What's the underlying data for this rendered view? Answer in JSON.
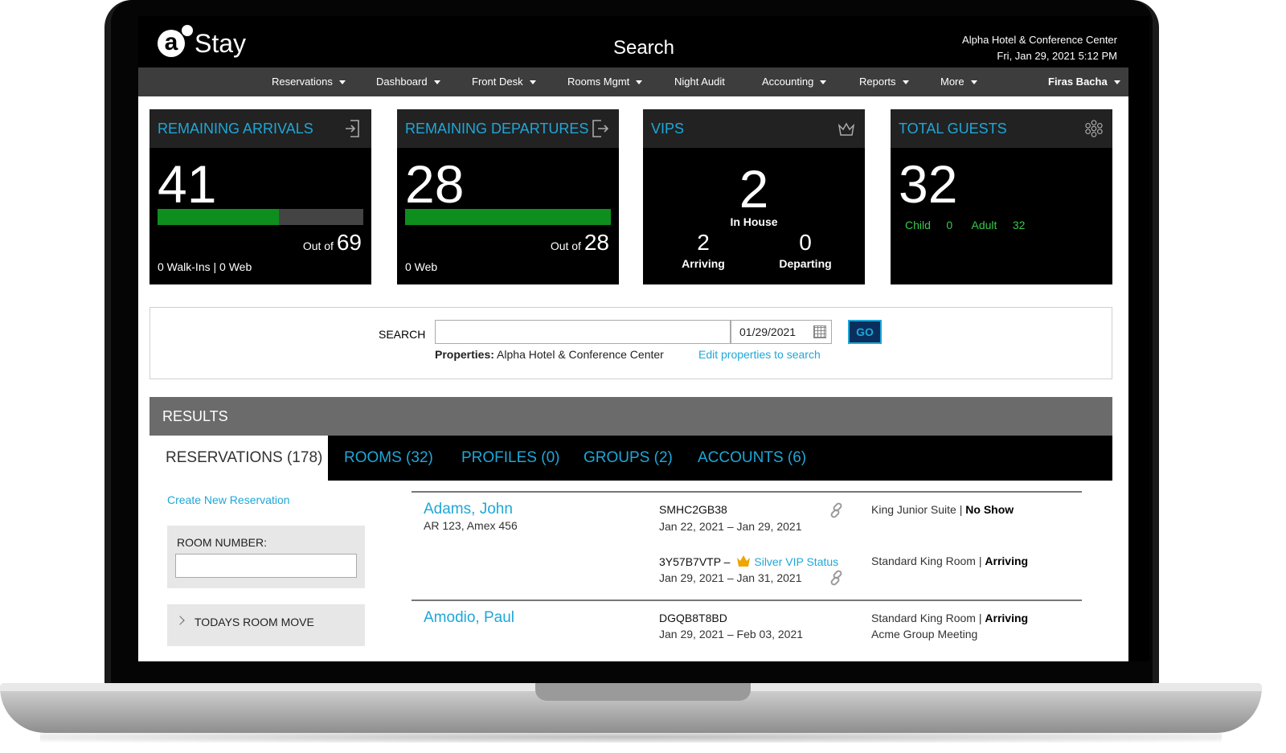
{
  "app": {
    "logo_letter": "a",
    "logo_name": "Stay",
    "page_title": "Search",
    "hotel_name": "Alpha Hotel & Conference Center",
    "datetime": "Fri, Jan 29, 2021 5:12 PM"
  },
  "nav": {
    "items": [
      "Reservations",
      "Dashboard",
      "Front Desk",
      "Rooms Mgmt",
      "Night Audit",
      "Accounting",
      "Reports",
      "More"
    ],
    "user": "Firas Bacha"
  },
  "cards": {
    "arrivals": {
      "title": "REMAINING ARRIVALS",
      "icon": "sign-in-icon",
      "value": "41",
      "out_of_label": "Out of",
      "out_of": "69",
      "progress": 0.59,
      "footer": "0 Walk-Ins   | 0 Web"
    },
    "departures": {
      "title": "REMAINING DEPARTURES",
      "icon": "sign-out-icon",
      "value": "28",
      "out_of_label": "Out of",
      "out_of": "28",
      "progress": 1.0,
      "footer": "0 Web"
    },
    "vips": {
      "title": "VIPS",
      "icon": "crown-icon",
      "value": "2",
      "in_house_label": "In House",
      "arriving": "2",
      "arriving_label": "Arriving",
      "departing": "0",
      "departing_label": "Departing"
    },
    "guests": {
      "title": "TOTAL GUESTS",
      "icon": "people-icon",
      "value": "32",
      "child_label": "Child",
      "child": "0",
      "adult_label": "Adult",
      "adult": "32"
    }
  },
  "search": {
    "label": "SEARCH",
    "query": "",
    "date": "01/29/2021",
    "go_label": "GO",
    "properties_label": "Properties:",
    "properties_value": "Alpha Hotel & Conference Center",
    "edit_link": "Edit properties to search"
  },
  "results": {
    "header": "RESULTS",
    "tabs": [
      "RESERVATIONS (178)",
      "ROOMS (32)",
      "PROFILES (0)",
      "GROUPS (2)",
      "ACCOUNTS (6)"
    ],
    "create_link": "Create New Reservation",
    "room_number_label": "ROOM NUMBER:",
    "room_number_value": "",
    "room_move_label": "TODAYS ROOM MOVE",
    "rows": [
      {
        "name": "Adams, John",
        "sub": "AR 123, Amex 456",
        "res": [
          {
            "conf": "SMHC2GB38",
            "dates": "Jan 22, 2021 – Jan 29, 2021",
            "room": "King Junior Suite |",
            "status": "No Show"
          },
          {
            "conf": "3Y57B7VTP –",
            "vip": "Silver VIP Status",
            "dates": "Jan 29, 2021 – Jan 31, 2021",
            "room": "Standard King Room |",
            "status": "Arriving"
          }
        ]
      },
      {
        "name": "Amodio, Paul",
        "sub": "",
        "res": [
          {
            "conf": "DGQB8T8BD",
            "dates": "Jan 29, 2021 – Feb 03, 2021",
            "room": "Standard King Room |",
            "status": "Arriving",
            "group": "Acme Group Meeting"
          }
        ]
      }
    ]
  },
  "colors": {
    "accent": "#1ea7d8",
    "progress": "#0e8e1d",
    "nav_bg": "#3d3d3d",
    "results_bg": "#6b6b6b",
    "green_text": "#36c94a",
    "vip_gold": "#f0a500"
  }
}
